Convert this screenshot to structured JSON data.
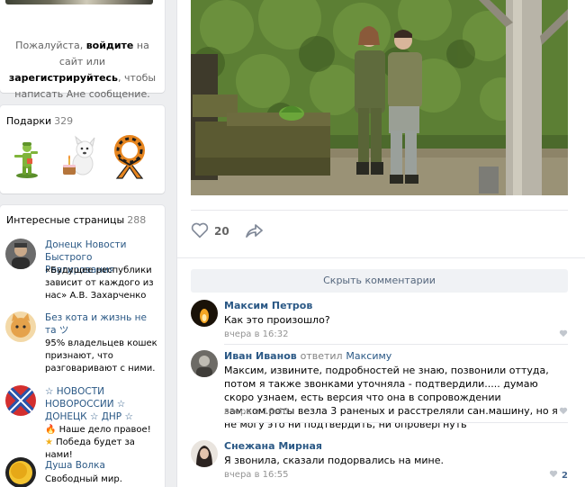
{
  "sidebar": {
    "login": {
      "line1_prefix": "Пожалуйста,",
      "line1_bold": "войдите",
      "line1_suffix": "на сайт или",
      "line2_bold": "зарегистрируйтесь",
      "line2_suffix": ", чтобы",
      "line3": "написать Ане сообщение."
    },
    "gifts": {
      "title": "Подарки",
      "count": "329"
    },
    "pages": {
      "title": "Интересные страницы",
      "count": "288",
      "items": [
        {
          "title": "Донецк Новости Быстрого Реагирования",
          "desc": "«Будущее республики зависит от каждого из нас» А.В. Захарченко"
        },
        {
          "title": "Без кота и жизнь не та ツ",
          "desc": "95% владельцев кошек признают, что разговаривают с ними."
        },
        {
          "title": "☆ НОВОСТИ НОВОРОССИИ ☆ ДОНЕЦК ☆ ДНР ☆",
          "desc_1": "Наше дело правое!",
          "desc_2": "Победа будет за нами!"
        },
        {
          "title": "Душа Волка",
          "desc": "Свободный мир."
        }
      ]
    }
  },
  "post": {
    "likes": "20",
    "hide_comments_label": "Скрыть комментарии"
  },
  "comments": [
    {
      "author": "Максим Петров",
      "text": "Как это произошло?",
      "date": "вчера в 16:32",
      "likes": ""
    },
    {
      "author": "Иван Иванов",
      "reply_word": "ответил",
      "reply_to": "Максиму",
      "text": "Максим, извините, подробностей не знаю, позвонили оттуда, потом я также звонками уточняла - подтвердили..... думаю скоро узнаем, есть версия что она в сопровождении зам.ком.роты везла 3 раненых и расстреляли сан.машину, но я не могу это ни подтвердить, ни опровергнуть",
      "date": "вчера в 16:46",
      "likes": ""
    },
    {
      "author": "Снежана Мирная",
      "text": "Я звонила, сказали подорвались на мине.",
      "date": "вчера в 16:55",
      "likes": "2"
    }
  ],
  "colors": {
    "link": "#2a5885",
    "background": "#edeef0",
    "muted": "#939393"
  }
}
